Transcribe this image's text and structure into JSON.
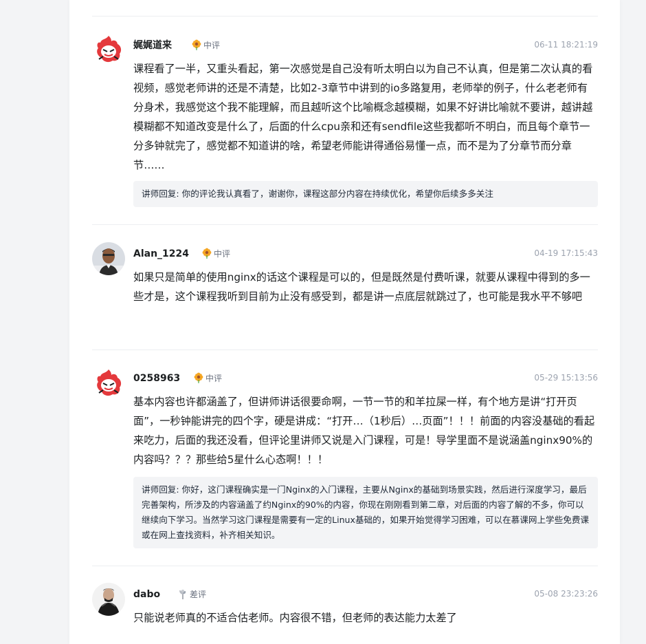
{
  "comments": [
    {
      "user": "娓娓道来",
      "rating": "中评",
      "rating_icon": "sunflower-icon",
      "time": "06-11 18:21:19",
      "avatar_icon": "flame-mascot-avatar",
      "content": "课程看了一半，又重头看起，第一次感觉是自己没有听太明白以为自己不认真，但是第二次认真的看视频，感觉老师讲的还是不清楚，比如2-3章节中讲到的io多路复用，老师举的例子，什么老老师有分身术，我感觉这个我不能理解，而且越听这个比喻概念越模糊，如果不好讲比喻就不要讲，越讲越模糊都不知道改变是什么了，后面的什么cpu亲和还有sendfile这些我都听不明白，而且每个章节一分多钟就完了，感觉都不知道讲的啥，希望老师能讲得通俗易懂一点，而不是为了分章节而分章节……",
      "reply": "讲师回复: 你的评论我认真看了，谢谢你，课程这部分内容在持续优化，希望你后续多多关注"
    },
    {
      "user": "Alan_1224",
      "rating": "中评",
      "rating_icon": "sunflower-icon",
      "time": "04-19 17:15:43",
      "avatar_icon": "person-photo-avatar",
      "content": "如果只是简单的使用nginx的话这个课程是可以的，但是既然是付费听课，就要从课程中得到的多一些才是，这个课程我听到目前为止没有感受到，都是讲一点底层就跳过了，也可能是我水平不够吧"
    },
    {
      "user": "0258963",
      "rating": "中评",
      "rating_icon": "sunflower-icon",
      "time": "05-29 15:13:56",
      "avatar_icon": "flame-mascot-avatar",
      "content": "基本内容也许都涵盖了，但讲师讲话很要命啊，一节一节的和羊拉屎一样，有个地方是讲“打开页面”，一秒钟能讲完的四个字，硬是讲成：“打开…（1秒后）…页面”！！！前面的内容没基础的看起来吃力，后面的我还没看，但评论里讲师又说是入门课程，可是！导学里面不是说涵盖nginx90%的内容吗？？？那些给5星什么心态啊！！！",
      "reply": "讲师回复: 你好，这门课程确实是一门Nginx的入门课程，主要从Nginx的基础到场景实践，然后进行深度学习，最后完善架构，所涉及的内容涵盖了约Nginx的90%的内容，你现在刚刚看到第二章，对后面的内容了解的不多，你可以继续向下学习。当然学习这门课程是需要有一定的Linux基础的，如果开始觉得学习困难，可以在慕课网上学些免费课或在网上查找资料，补齐相关知识。"
    },
    {
      "user": "dabo",
      "rating": "差评",
      "rating_icon": "wilted-plant-icon",
      "time": "05-08 23:23:26",
      "avatar_icon": "person-photo-avatar",
      "content": "只能说老师真的不适合估老师。内容很不错，但老师的表达能力太差了"
    }
  ],
  "colors": {
    "background": "#f3f4f6",
    "card": "#ffffff",
    "text": "#1c1f21",
    "muted": "#9ca3af",
    "reply_bg": "#f3f4f6",
    "mascot_red": "#e4393c",
    "sunflower": "#f5a623"
  }
}
